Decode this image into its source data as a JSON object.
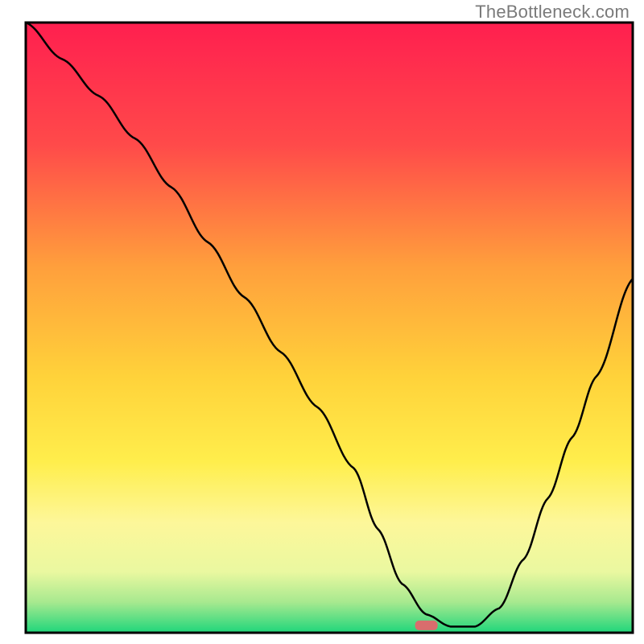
{
  "watermark": "TheBottleneck.com",
  "chart_data": {
    "type": "line",
    "title": "",
    "xlabel": "",
    "ylabel": "",
    "xlim": [
      0,
      100
    ],
    "ylim": [
      0,
      100
    ],
    "grid": false,
    "series": [
      {
        "name": "bottleneck-curve",
        "x": [
          0,
          6,
          12,
          18,
          24,
          30,
          36,
          42,
          48,
          54,
          58,
          62,
          66,
          70,
          74,
          78,
          82,
          86,
          90,
          94,
          100
        ],
        "values": [
          100,
          94,
          88,
          81,
          73,
          64,
          55,
          46,
          37,
          27,
          17,
          8,
          3,
          1,
          1,
          4,
          12,
          22,
          32,
          42,
          58
        ]
      }
    ],
    "marker": {
      "x": 66,
      "y": 1.2,
      "color": "#d96d6d"
    },
    "background_gradient": {
      "stops": [
        {
          "offset": 0,
          "color": "#ff1f4f"
        },
        {
          "offset": 20,
          "color": "#ff4a4a"
        },
        {
          "offset": 40,
          "color": "#ff9f3c"
        },
        {
          "offset": 58,
          "color": "#ffd23a"
        },
        {
          "offset": 72,
          "color": "#ffee4c"
        },
        {
          "offset": 82,
          "color": "#fdf79a"
        },
        {
          "offset": 90,
          "color": "#eaf8a0"
        },
        {
          "offset": 95,
          "color": "#a7e98f"
        },
        {
          "offset": 100,
          "color": "#1fd67b"
        }
      ]
    },
    "frame_color": "#000000",
    "line_color": "#000000",
    "line_width": 2.5
  }
}
